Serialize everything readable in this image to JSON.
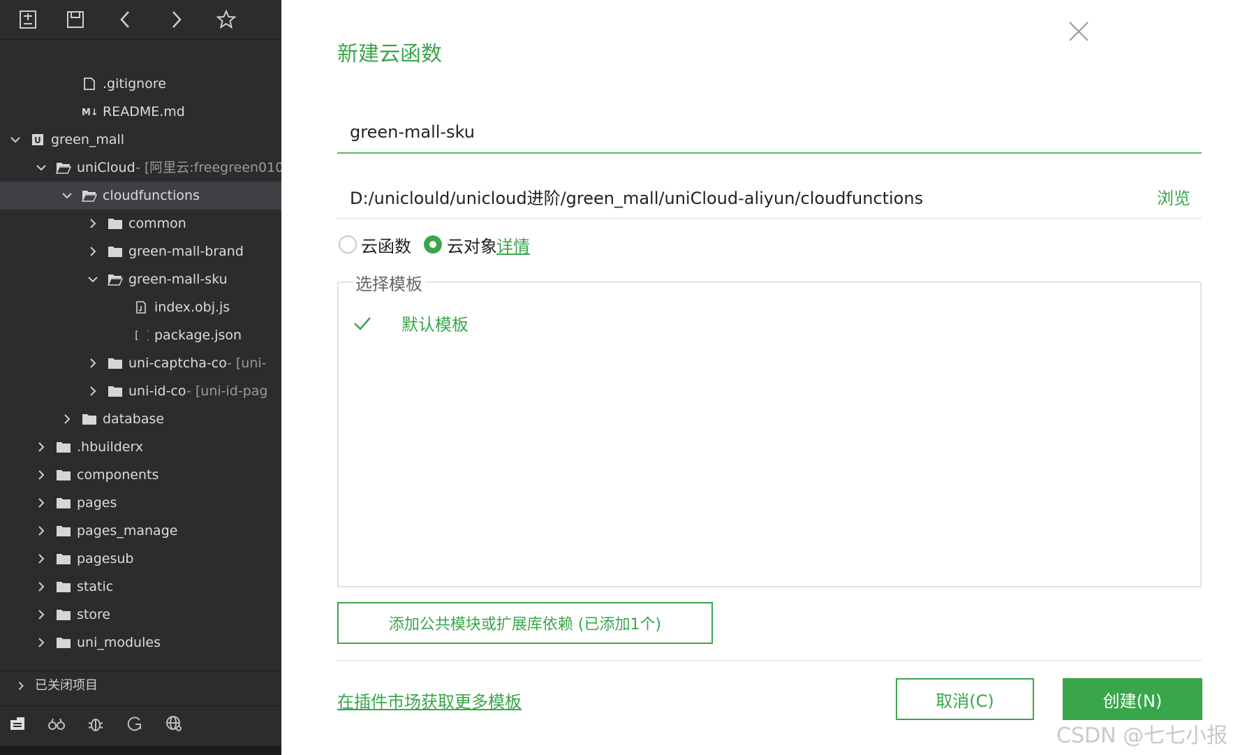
{
  "sidebar": {
    "tree": [
      {
        "label": ".gitignore",
        "depth": 2,
        "icon": "file-icon",
        "chevron": "none"
      },
      {
        "label": "README.md",
        "depth": 2,
        "icon": "markdown-icon",
        "chevron": "none"
      },
      {
        "label": "green_mall",
        "depth": 0,
        "icon": "project-icon",
        "chevron": "down"
      },
      {
        "label": "uniCloud",
        "sub": " - [阿里云:freegreen010",
        "depth": 1,
        "icon": "folder-open-icon",
        "chevron": "down"
      },
      {
        "label": "cloudfunctions",
        "depth": 2,
        "icon": "folder-open-icon",
        "chevron": "down",
        "selected": true
      },
      {
        "label": "common",
        "depth": 3,
        "icon": "folder-icon",
        "chevron": "right"
      },
      {
        "label": "green-mall-brand",
        "depth": 3,
        "icon": "folder-icon",
        "chevron": "right"
      },
      {
        "label": "green-mall-sku",
        "depth": 3,
        "icon": "folder-open-icon",
        "chevron": "down"
      },
      {
        "label": "index.obj.js",
        "depth": 4,
        "icon": "js-file-icon",
        "chevron": "none"
      },
      {
        "label": "package.json",
        "depth": 4,
        "icon": "json-icon",
        "chevron": "none"
      },
      {
        "label": "uni-captcha-co",
        "sub": " - [uni-",
        "depth": 3,
        "icon": "folder-icon",
        "chevron": "right"
      },
      {
        "label": "uni-id-co",
        "sub": " - [uni-id-pag",
        "depth": 3,
        "icon": "folder-icon",
        "chevron": "right"
      },
      {
        "label": "database",
        "depth": 2,
        "icon": "folder-icon",
        "chevron": "right"
      },
      {
        "label": ".hbuilderx",
        "depth": 1,
        "icon": "folder-icon",
        "chevron": "right"
      },
      {
        "label": "components",
        "depth": 1,
        "icon": "folder-icon",
        "chevron": "right"
      },
      {
        "label": "pages",
        "depth": 1,
        "icon": "folder-icon",
        "chevron": "right"
      },
      {
        "label": "pages_manage",
        "depth": 1,
        "icon": "folder-icon",
        "chevron": "right"
      },
      {
        "label": "pagesub",
        "depth": 1,
        "icon": "folder-icon",
        "chevron": "right"
      },
      {
        "label": "static",
        "depth": 1,
        "icon": "folder-icon",
        "chevron": "right"
      },
      {
        "label": "store",
        "depth": 1,
        "icon": "folder-icon",
        "chevron": "right"
      },
      {
        "label": "uni_modules",
        "depth": 1,
        "icon": "folder-icon",
        "chevron": "right"
      }
    ],
    "closed_projects": "已关闭项目"
  },
  "dialog": {
    "title": "新建云函数",
    "name_value": "green-mall-sku",
    "path": "D:/uniclould/unicloud进阶/green_mall/uniCloud-aliyun/cloudfunctions",
    "browse": "浏览",
    "radio_function": "云函数",
    "radio_object": "云对象",
    "selected_type": "云对象",
    "detail": "详情",
    "template_legend": "选择模板",
    "template_default": "默认模板",
    "add_dependency": "添加公共模块或扩展库依赖 (已添加1个)",
    "market_link": "在插件市场获取更多模板",
    "cancel": "取消(C)",
    "create": "创建(N)",
    "accent_color": "#3aa64b"
  },
  "watermark": "CSDN @七七小报"
}
